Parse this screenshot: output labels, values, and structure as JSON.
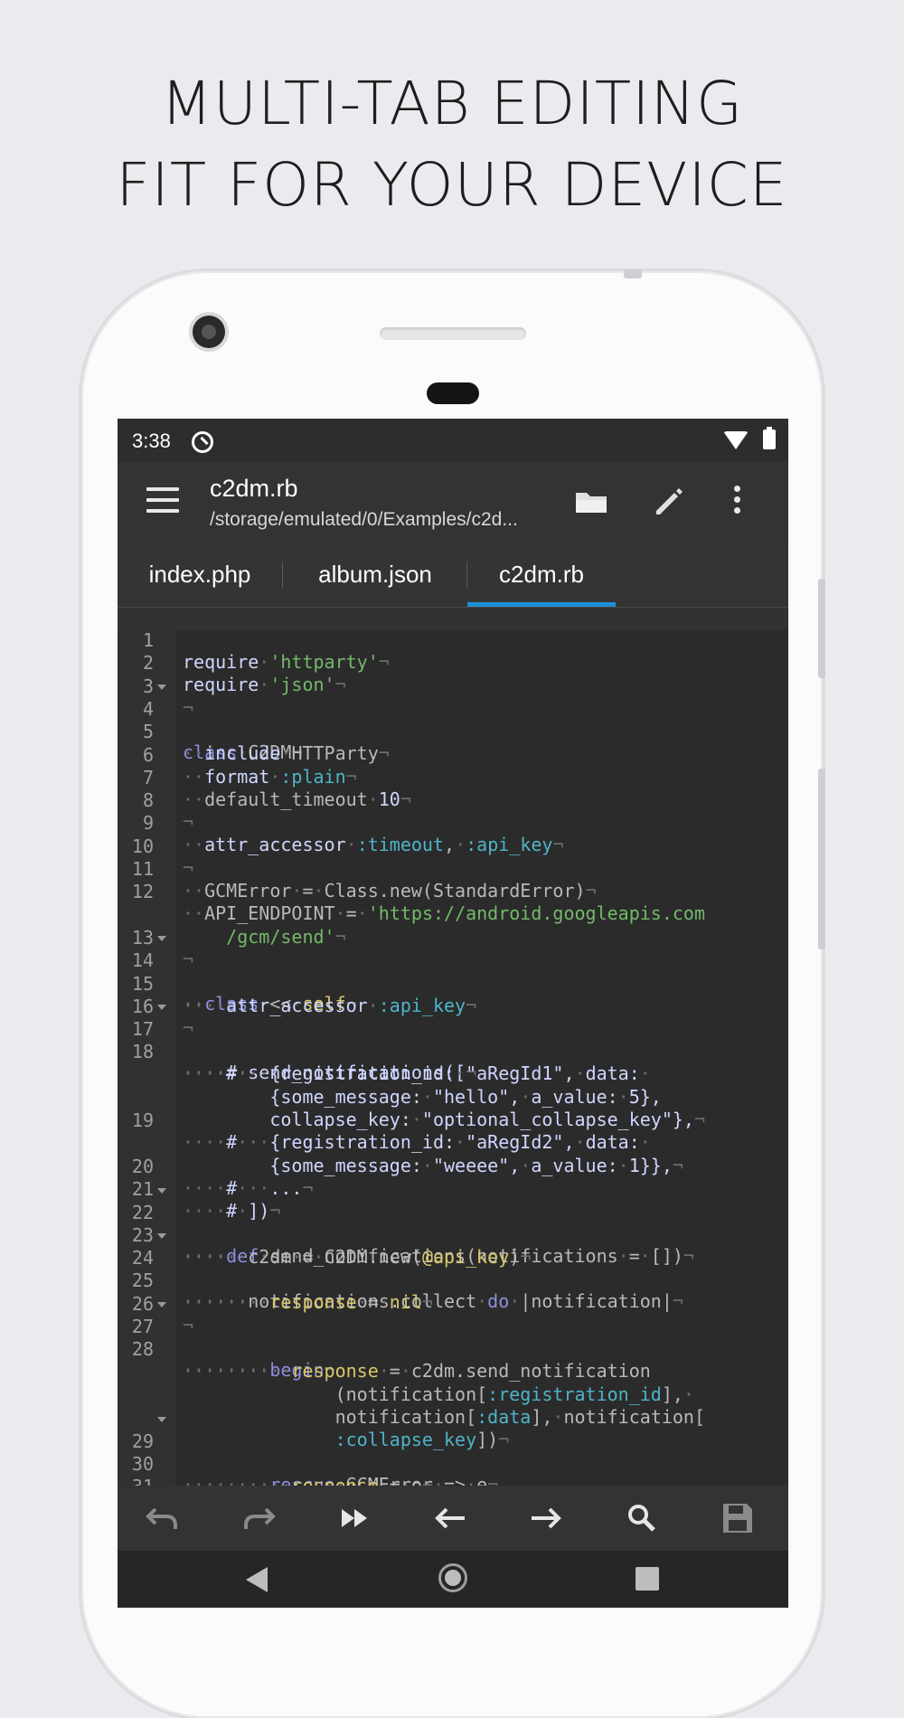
{
  "headline": {
    "line1": "MULTI-TAB EDITING",
    "line2": "FIT FOR YOUR DEVICE"
  },
  "status_bar": {
    "time": "3:38",
    "icons": [
      "sync-icon",
      "wifi-icon",
      "battery-icon"
    ]
  },
  "toolbar": {
    "title": "c2dm.rb",
    "path": "/storage/emulated/0/Examples/c2d...",
    "icons": [
      "hamburger-menu-icon",
      "folder-open-icon",
      "pencil-edit-icon",
      "more-vert-icon"
    ]
  },
  "tabs": [
    {
      "label": "index.php",
      "active": false
    },
    {
      "label": "album.json",
      "active": false
    },
    {
      "label": "c2dm.rb",
      "active": true
    }
  ],
  "editor": {
    "line_numbers": [
      "1",
      "2",
      "3",
      "4",
      "5",
      "6",
      "7",
      "8",
      "9",
      "10",
      "11",
      "12",
      "13",
      "14",
      "15",
      "16",
      "17",
      "18",
      "19",
      "20",
      "21",
      "22",
      "23",
      "24",
      "25",
      "26",
      "27",
      "28",
      "29",
      "30",
      "31"
    ]
  },
  "bottom_toolbar": {
    "icons": [
      "undo-icon",
      "redo-icon",
      "fast-forward-icon",
      "arrow-left-icon",
      "arrow-right-icon",
      "search-icon",
      "save-icon"
    ]
  },
  "nav_bar": {
    "icons": [
      "nav-back-icon",
      "nav-home-icon",
      "nav-recents-icon"
    ]
  },
  "colors": {
    "accent": "#1e8fd6",
    "background": "#ebebef",
    "editor_bg": "#2b2b2b",
    "keyword": "#8e8ee0",
    "string": "#74b96a",
    "symbol": "#4fb3c8",
    "ivar": "#d8c76a"
  }
}
